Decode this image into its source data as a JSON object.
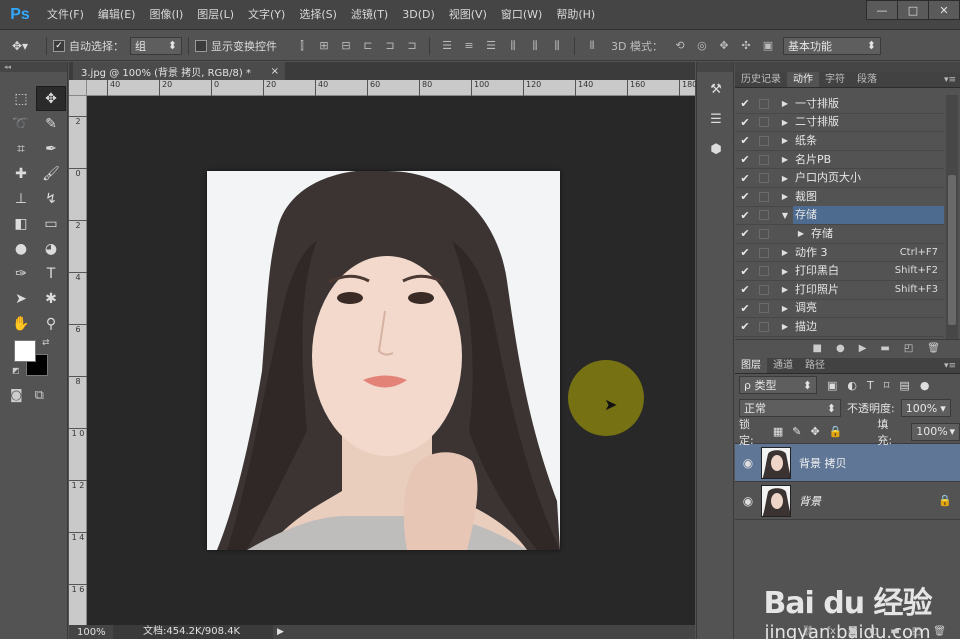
{
  "app": {
    "logo": "Ps"
  },
  "menu": [
    "文件(F)",
    "编辑(E)",
    "图像(I)",
    "图层(L)",
    "文字(Y)",
    "选择(S)",
    "滤镜(T)",
    "3D(D)",
    "视图(V)",
    "窗口(W)",
    "帮助(H)"
  ],
  "window_controls": {
    "minimize": "—",
    "restore": "□",
    "close": "✕"
  },
  "options": {
    "tool_icon": "move-tool-icon",
    "auto_select_label": "自动选择：",
    "auto_select_checked": true,
    "auto_select_value": "组",
    "show_transform_label": "显示变换控件",
    "show_transform_checked": false,
    "mode_3d_label": "3D 模式：",
    "workspace_value": "基本功能"
  },
  "document": {
    "tab_title": "3.jpg @ 100% (背景 拷贝, RGB/8) *",
    "tab_close": "×",
    "zoom": "100%",
    "doc_size": "文档:454.2K/908.4K",
    "ruler_top": [
      "40",
      "20",
      "0",
      "20",
      "40",
      "60",
      "80",
      "100",
      "120",
      "140",
      "160",
      "180"
    ],
    "ruler_left": [
      "2",
      "0",
      "2",
      "4",
      "6",
      "8",
      "1 0",
      "1 2",
      "1 4",
      "1 6"
    ]
  },
  "tools": {
    "foreground_color": "#ffffff",
    "background_color": "#000000"
  },
  "panels": {
    "top_tabs": [
      "历史记录",
      "动作",
      "字符",
      "段落"
    ],
    "active_top_tab": "动作",
    "actions": [
      {
        "name": "一寸排版",
        "shortcut": "",
        "expanded": false,
        "child": false
      },
      {
        "name": "二寸排版",
        "shortcut": "",
        "expanded": false,
        "child": false
      },
      {
        "name": "纸条",
        "shortcut": "",
        "expanded": false,
        "child": false
      },
      {
        "name": "名片PB",
        "shortcut": "",
        "expanded": false,
        "child": false
      },
      {
        "name": "户口内页大小",
        "shortcut": "",
        "expanded": false,
        "child": false
      },
      {
        "name": "裁图",
        "shortcut": "",
        "expanded": false,
        "child": false
      },
      {
        "name": "存储",
        "shortcut": "",
        "expanded": true,
        "child": false,
        "selected": true
      },
      {
        "name": "存储",
        "shortcut": "",
        "expanded": false,
        "child": true
      },
      {
        "name": "动作 3",
        "shortcut": "Ctrl+F7",
        "expanded": false,
        "child": false
      },
      {
        "name": "打印黑白",
        "shortcut": "Shift+F2",
        "expanded": false,
        "child": false
      },
      {
        "name": "打印照片",
        "shortcut": "Shift+F3",
        "expanded": false,
        "child": false
      },
      {
        "name": "调亮",
        "shortcut": "",
        "expanded": false,
        "child": false
      },
      {
        "name": "描边",
        "shortcut": "",
        "expanded": false,
        "child": false
      }
    ],
    "layer_tabs": [
      "图层",
      "通道",
      "路径"
    ],
    "active_layer_tab": "图层",
    "filter_label": "ρ 类型",
    "blend_mode": "正常",
    "opacity_label": "不透明度:",
    "opacity_value": "100%",
    "lock_label": "锁定:",
    "fill_label": "填充:",
    "fill_value": "100%",
    "layers": [
      {
        "name": "背景 拷贝",
        "selected": true,
        "locked": false,
        "italic": false
      },
      {
        "name": "背景",
        "selected": false,
        "locked": true,
        "italic": true
      }
    ]
  },
  "watermark": {
    "brand": "Bai du 经验",
    "url": "jingyan.baidu.com"
  }
}
